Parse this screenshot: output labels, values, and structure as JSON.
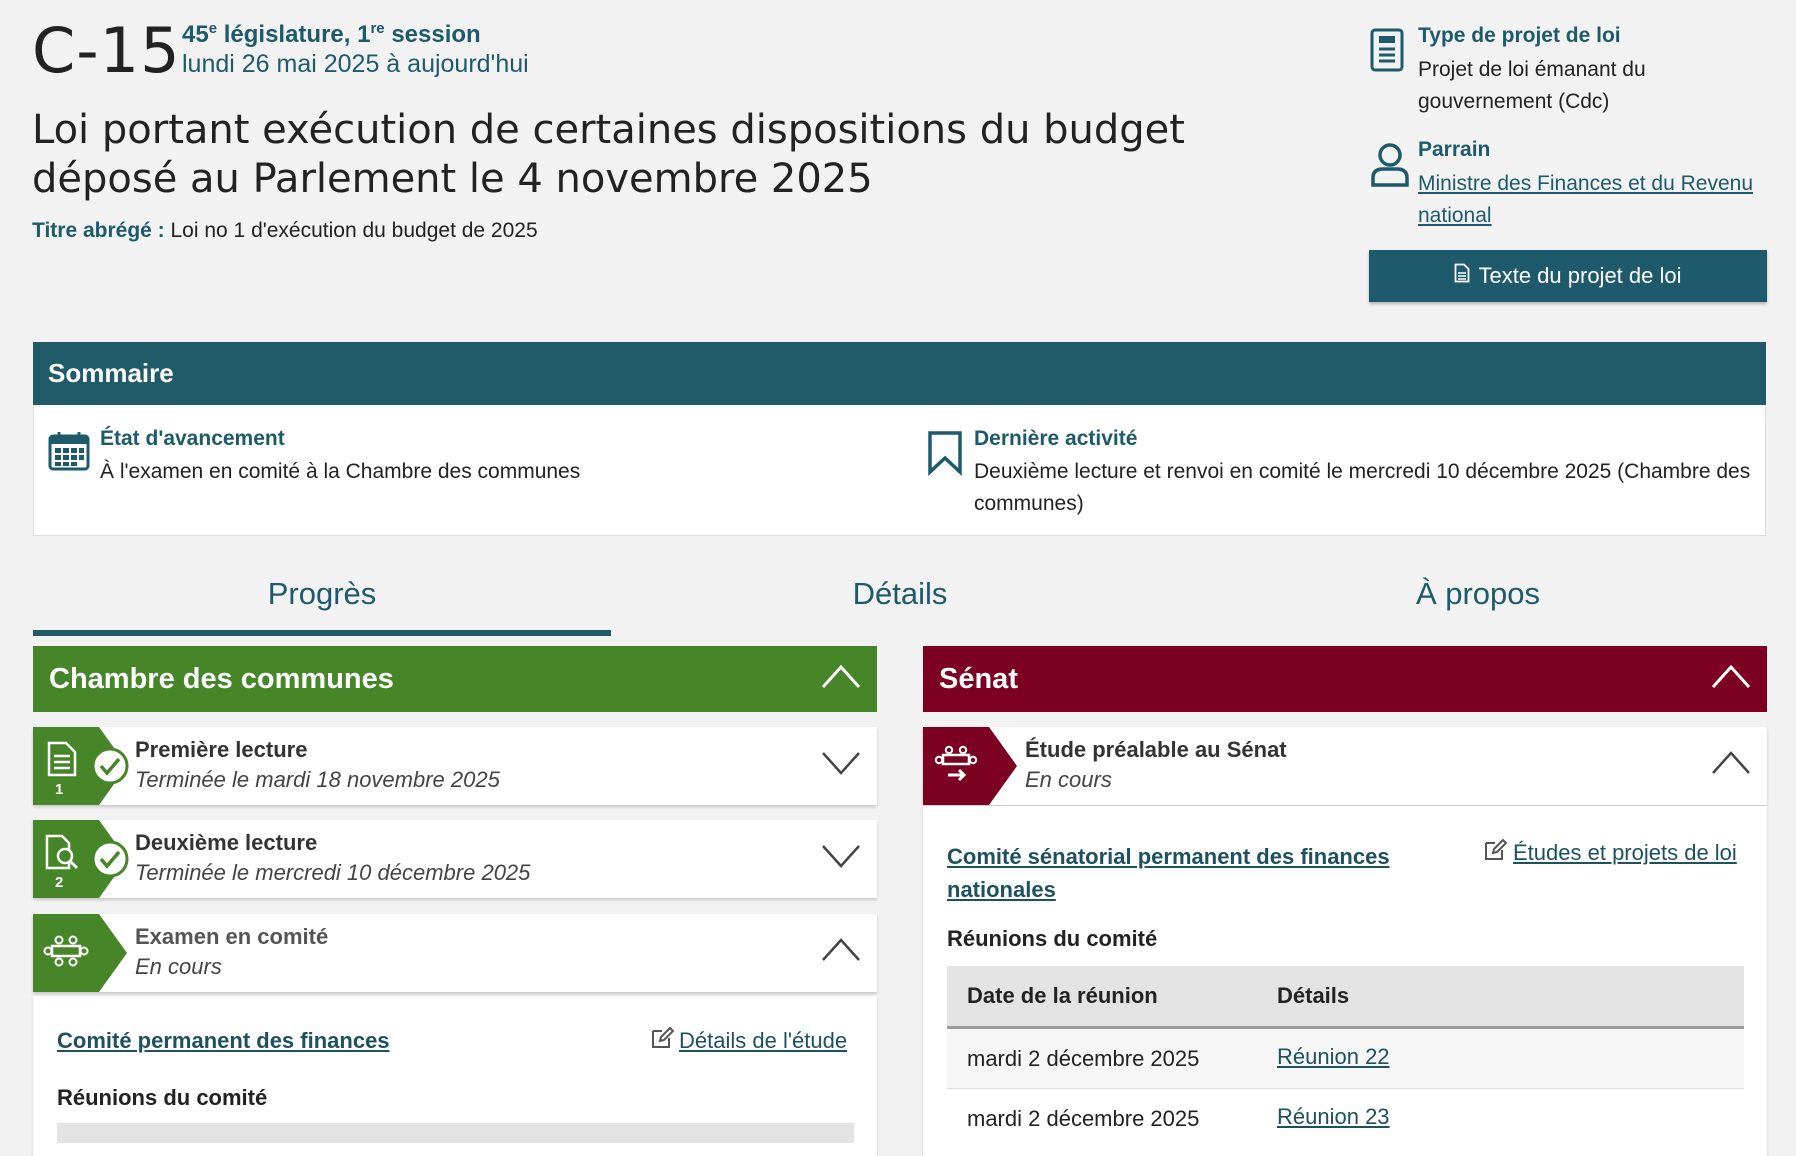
{
  "header": {
    "bill_number": "C-15",
    "parliament": "45",
    "parliament_sup": "e",
    "legislature_word": "législature, 1",
    "session_sup": "re",
    "session_word": "session",
    "date_range": "lundi 26 mai 2025 à aujourd'hui",
    "title": "Loi portant exécution de certaines dispositions du budget déposé au Parlement le 4 novembre 2025",
    "short_title_label": "Titre abrégé :",
    "short_title": "Loi no 1 d'exécution du budget de 2025"
  },
  "meta": {
    "type_label": "Type de projet de loi",
    "type_value": "Projet de loi émanant du gouvernement (Cdc)",
    "sponsor_label": "Parrain",
    "sponsor_value": "Ministre des Finances et du Revenu national",
    "text_button": "Texte du projet de loi"
  },
  "summary": {
    "heading": "Sommaire",
    "status_label": "État d'avancement",
    "status_value": "À l'examen en comité à la Chambre des communes",
    "last_label": "Dernière activité",
    "last_value": "Deuxième lecture et renvoi en comité le mercredi 10 décembre 2025 (Chambre des communes)"
  },
  "tabs": [
    {
      "label": "Progrès",
      "active": true
    },
    {
      "label": "Détails",
      "active": false
    },
    {
      "label": "À propos",
      "active": false
    }
  ],
  "house": {
    "heading": "Chambre des communes",
    "color": "#468629",
    "stages": [
      {
        "title": "Première lecture",
        "sub": "Terminée le mardi 18 novembre 2025",
        "num": "1"
      },
      {
        "title": "Deuxième lecture",
        "sub": "Terminée le mercredi 10 décembre 2025",
        "num": "2"
      },
      {
        "title": "Examen en comité",
        "sub": "En cours"
      }
    ],
    "committee_link": "Comité permanent des finances",
    "study_link": "Détails de l'étude",
    "meetings_label": "Réunions du comité"
  },
  "senate": {
    "heading": "Sénat",
    "color": "#7b0021",
    "stage_title": "Étude préalable au Sénat",
    "stage_sub": "En cours",
    "committee_link": "Comité sénatorial permanent des finances nationales",
    "studies_link": "Études et projets de loi",
    "meetings_label": "Réunions du comité",
    "table_headers": [
      "Date de la réunion",
      "Détails"
    ],
    "rows": [
      {
        "date": "mardi 2 décembre 2025",
        "link": "Réunion 22"
      },
      {
        "date": "mardi 2 décembre 2025",
        "link": "Réunion 23"
      }
    ]
  }
}
